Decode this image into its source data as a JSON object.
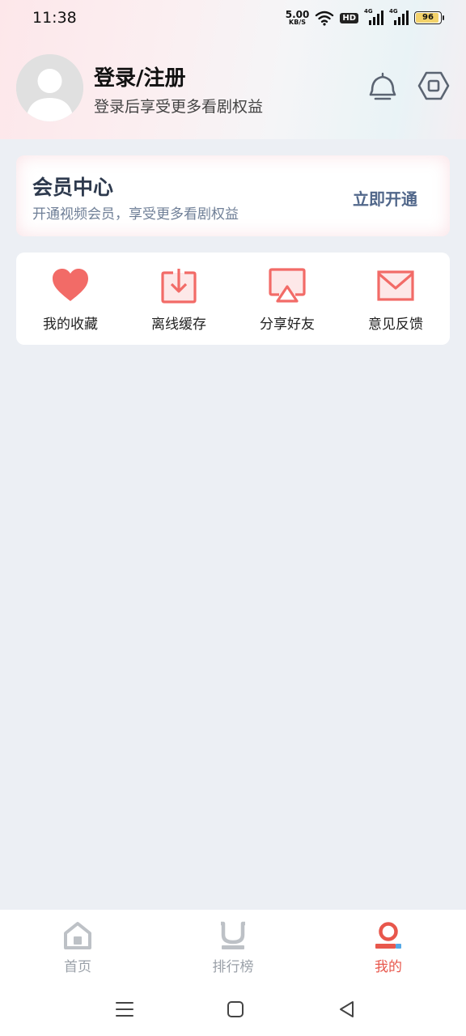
{
  "status_bar": {
    "time": "11:38",
    "net_speed_value": "5.00",
    "net_speed_unit": "KB/S",
    "hd": "HD",
    "signal1": "4G",
    "signal2": "4G",
    "battery": "96"
  },
  "profile": {
    "title": "登录/注册",
    "subtitle": "登录后享受更多看剧权益",
    "icons": [
      "bell-icon",
      "settings-icon"
    ]
  },
  "member": {
    "title": "会员中心",
    "subtitle": "开通视频会员，享受更多看剧权益",
    "button": "立即开通"
  },
  "actions": [
    {
      "label": "我的收藏",
      "icon": "heart-icon"
    },
    {
      "label": "离线缓存",
      "icon": "download-icon"
    },
    {
      "label": "分享好友",
      "icon": "share-icon"
    },
    {
      "label": "意见反馈",
      "icon": "mail-icon"
    }
  ],
  "bottom_nav": [
    {
      "label": "首页",
      "icon": "home-icon",
      "active": false
    },
    {
      "label": "排行榜",
      "icon": "ranking-icon",
      "active": false
    },
    {
      "label": "我的",
      "icon": "profile-icon",
      "active": true
    }
  ],
  "colors": {
    "accent": "#e8574c",
    "icon_red": "#f26b67",
    "member_button": "#51678a",
    "background": "#eceff4"
  }
}
